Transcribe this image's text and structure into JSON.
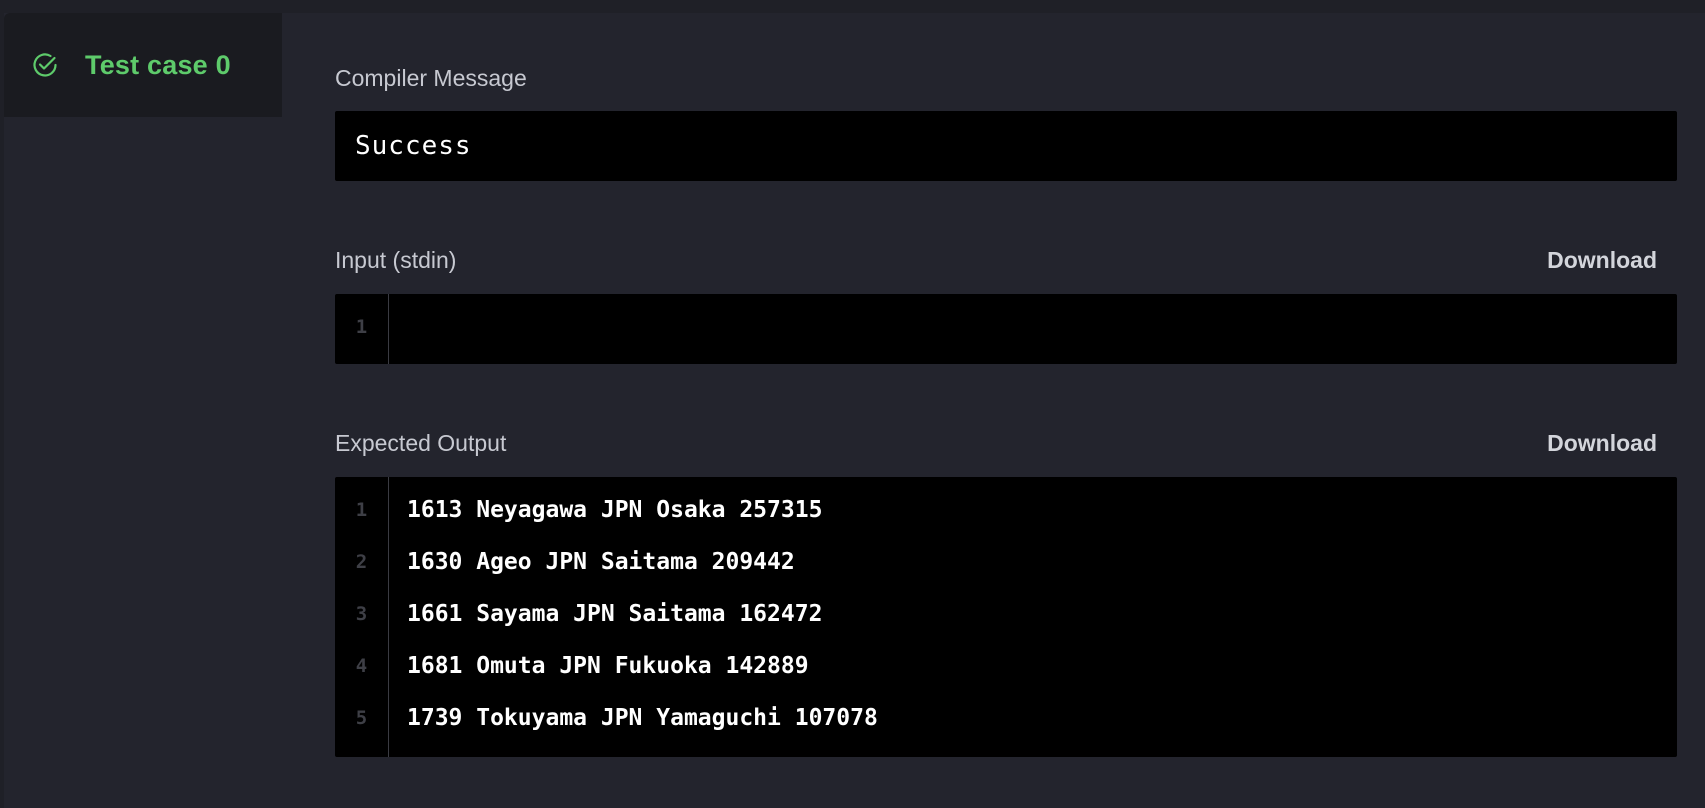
{
  "test_case": {
    "label": "Test case 0",
    "status_color": "#5ecb6b"
  },
  "compiler": {
    "label": "Compiler Message",
    "message": "Success"
  },
  "input": {
    "label": "Input (stdin)",
    "download_label": "Download",
    "line_numbers": [
      "1"
    ],
    "lines": [
      ""
    ]
  },
  "expected_output": {
    "label": "Expected Output",
    "download_label": "Download",
    "line_numbers": [
      "1",
      "2",
      "3",
      "4",
      "5"
    ],
    "lines": [
      "1613 Neyagawa JPN Osaka 257315",
      "1630 Ageo JPN Saitama 209442",
      "1661 Sayama JPN Saitama 162472",
      "1681 Omuta JPN Fukuoka 142889",
      "1739 Tokuyama JPN Yamaguchi 107078"
    ]
  }
}
